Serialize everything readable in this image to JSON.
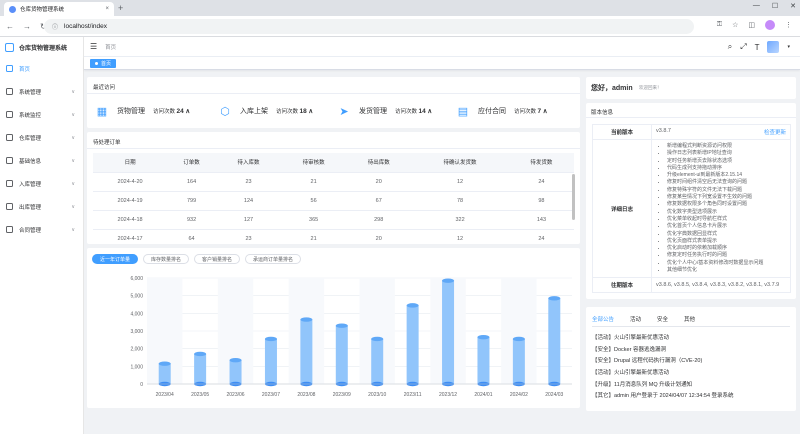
{
  "browser": {
    "tab_title": "仓库货物管理系统",
    "tab_close": "×",
    "new_tab": "+",
    "url": "localhost/index"
  },
  "sidebar": {
    "app_title": "仓库货物管理系统",
    "items": [
      {
        "label": "首页",
        "active": true
      },
      {
        "label": "系统管理"
      },
      {
        "label": "系统监控"
      },
      {
        "label": "仓库管理"
      },
      {
        "label": "基础信息"
      },
      {
        "label": "入库管理"
      },
      {
        "label": "出库管理"
      },
      {
        "label": "合同管理"
      }
    ]
  },
  "header": {
    "breadcrumb": "首页"
  },
  "tags": {
    "active_tag": "首页"
  },
  "recent": {
    "title": "最近访问",
    "shortcuts": [
      {
        "name": "货物管理",
        "label": "访问次数",
        "count": "24"
      },
      {
        "name": "入库上架",
        "label": "访问次数",
        "count": "18"
      },
      {
        "name": "发货管理",
        "label": "访问次数",
        "count": "14"
      },
      {
        "name": "应付合同",
        "label": "访问次数",
        "count": "7"
      }
    ]
  },
  "orders": {
    "title": "待处理订单",
    "headers": [
      "日期",
      "订单数",
      "待入库数",
      "待审核数",
      "待出库数",
      "待确认发货数",
      "待发货数"
    ],
    "rows": [
      [
        "2024-4-20",
        "164",
        "23",
        "21",
        "20",
        "12",
        "24"
      ],
      [
        "2024-4-19",
        "799",
        "124",
        "56",
        "67",
        "78",
        "98"
      ],
      [
        "2024-4-18",
        "932",
        "127",
        "365",
        "298",
        "322",
        "143"
      ],
      [
        "2024-4-17",
        "64",
        "23",
        "21",
        "20",
        "12",
        "24"
      ]
    ]
  },
  "chart_tabs": [
    "近一年订单量",
    "库存数量排名",
    "客户销量排名",
    "承运商订单量排名"
  ],
  "chart_data": {
    "type": "bar",
    "categories": [
      "2023/04",
      "2023/05",
      "2023/06",
      "2023/07",
      "2023/08",
      "2023/09",
      "2023/10",
      "2023/11",
      "2023/12",
      "2024/01",
      "2024/02",
      "2024/03"
    ],
    "values": [
      1150,
      1700,
      1350,
      2550,
      3650,
      3300,
      2550,
      4450,
      5850,
      2650,
      2550,
      4850
    ],
    "ylim": [
      0,
      6000
    ],
    "yticks": [
      0,
      1000,
      2000,
      3000,
      4000,
      5000,
      6000
    ],
    "bar_color": "#91c5fb",
    "grid": true
  },
  "welcome": {
    "greeting": "您好，admin",
    "sub": "欢迎回来！"
  },
  "version": {
    "title": "版本信息",
    "current_label": "当前版本",
    "current_value": "v3.8.7",
    "check_update": "检查更新",
    "log_label": "详细日志",
    "log_items": [
      "新增编程式判断资源访问权限",
      "操作日志列表新增IP地址查询",
      "定时任务新增页去除状态选项",
      "代码生成列支持拖动排序",
      "升级element-ui到最新版本2.15.14",
      "修复时间组件清空后无法查询的问题",
      "修复特殊字符的文件无法下载问题",
      "修复某些情况下列宽设置不生效的问题",
      "修复数据权限多个角色同时设置问题",
      "优化数字类型选项展示",
      "优化菜单收起时导航栏样式",
      "优化首页个人信息卡片展示",
      "优化字典数据回显样式",
      "优化页面样式表单提示",
      "优化启动时的依赖加载顺序",
      "修复定时任务执行时的问题",
      "优化个人中心/基本资料修改时数据显示问题",
      "其他细节优化"
    ],
    "release_label": "往期版本",
    "release_value": "v3.8.6, v3.8.5, v3.8.4, v3.8.3, v3.8.2, v3.8.1, v3.7.9"
  },
  "notice": {
    "tabs": [
      "全部公告",
      "活动",
      "安全",
      "其他"
    ],
    "items": [
      "【活动】火山引擎最新优惠活动",
      "【安全】Docker 容器逃逸漏洞",
      "【安全】Drupal 远程代码执行漏洞（CVE-20)",
      "【活动】火山引擎最新优惠活动",
      "【升级】11月消息队列 MQ 升级计划通知",
      "【其它】admin 用户登录于 2024/04/07 12:34:54 登录系统"
    ]
  }
}
